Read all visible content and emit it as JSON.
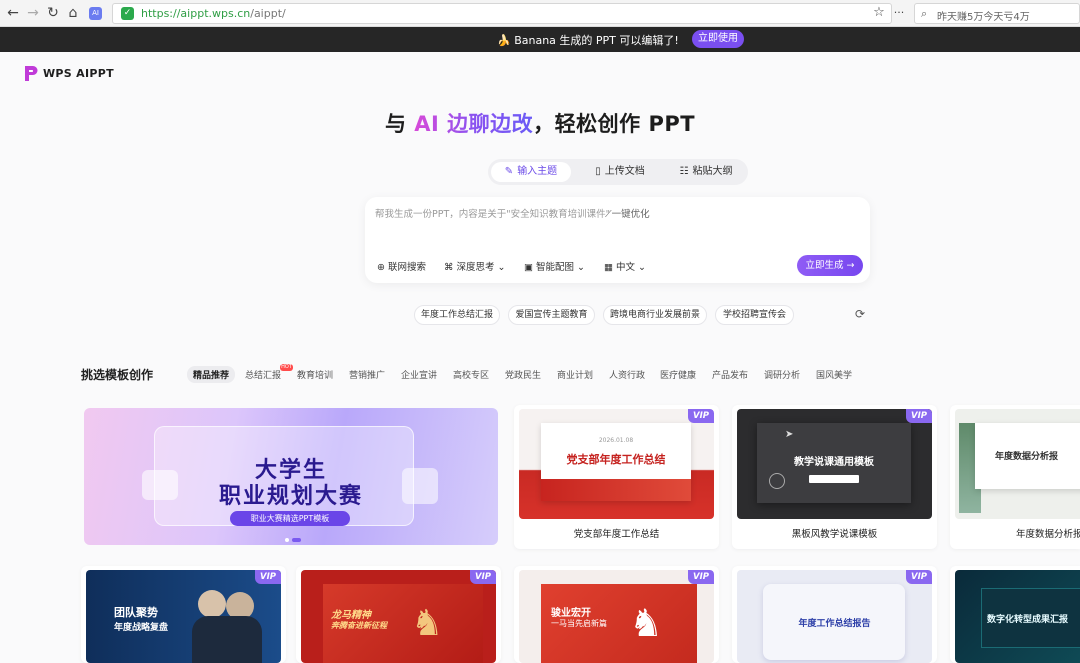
{
  "browser": {
    "url_domain": "https://aippt.wps.cn",
    "url_path": "/aippt/",
    "search_text": "昨天赚5万今天亏4万"
  },
  "banner": {
    "emoji": "🍌",
    "message": "Banana 生成的 PPT 可以编辑了!",
    "button": "立即使用"
  },
  "logo": {
    "name": "WPS AIPPT"
  },
  "hero": {
    "prefix": "与 ",
    "highlight": "AI 边聊边改",
    "suffix": "，轻松创作 PPT"
  },
  "tabs": [
    {
      "label": "输入主题",
      "icon": "✎",
      "active": true
    },
    {
      "label": "上传文档",
      "icon": "▯"
    },
    {
      "label": "粘贴大纲",
      "icon": "☷"
    }
  ],
  "input": {
    "placeholder": "帮我生成一份PPT，内容是关于\"安全知识教育培训课件\"",
    "optimize": "一键优化",
    "tools": [
      {
        "label": "联网搜索",
        "icon": "⊕"
      },
      {
        "label": "深度思考",
        "icon": "⌘",
        "caret": "⌄"
      },
      {
        "label": "智能配图",
        "icon": "▣",
        "caret": "⌄"
      },
      {
        "label": "中文",
        "icon": "▦",
        "caret": "⌄"
      }
    ],
    "generate": "立即生成 →"
  },
  "suggestions": [
    "年度工作总结汇报",
    "爱国宣传主题教育",
    "跨境电商行业发展前景",
    "学校招聘宣传会"
  ],
  "templates": {
    "section_title": "挑选模板创作",
    "categories": [
      "精品推荐",
      "总结汇报",
      "教育培训",
      "营销推广",
      "企业宣讲",
      "高校专区",
      "党政民生",
      "商业计划",
      "人资行政",
      "医疗健康",
      "产品发布",
      "调研分析",
      "国风美学"
    ],
    "hot_badge": "HOT",
    "vip_label": "VIP",
    "featured": {
      "title_1": "大学生",
      "title_2": "职业规划大赛",
      "subtitle": "职业大赛精选PPT模板"
    },
    "row1": [
      {
        "caption": "党支部年度工作总结",
        "slide_title": "党支部年度工作总结",
        "slide_date": "2026.01.08"
      },
      {
        "caption": "黑板风教学说课模板",
        "slide_title": "教学说课通用模板"
      },
      {
        "caption": "年度数据分析报",
        "slide_title": "年度数据分析报"
      }
    ],
    "row2": [
      {
        "slide_title": "团队聚势",
        "slide_subtitle": "年度战略复盘"
      },
      {
        "slide_title": "龙马精神",
        "slide_subtitle": "奔腾奋进新征程"
      },
      {
        "slide_title": "骏业宏开",
        "slide_subtitle": "一马当先启新篇"
      },
      {
        "slide_title": "年度工作总结报告"
      },
      {
        "slide_title": "数字化转型成果汇报"
      }
    ]
  }
}
